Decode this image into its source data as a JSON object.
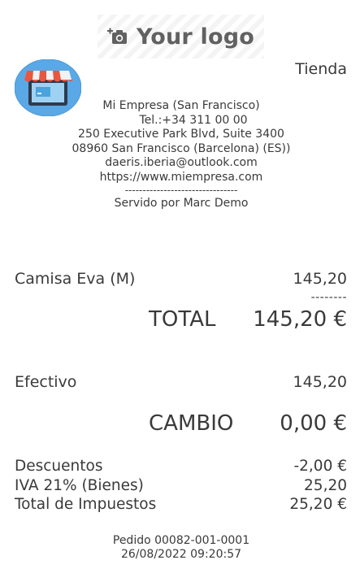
{
  "logo": {
    "text": "Your logo",
    "icon": "camera-plus-icon"
  },
  "shop_icon": "storefront-icon",
  "store_label": "Tienda",
  "company": {
    "name": "Mi Empresa (San Francisco)",
    "phone": "Tel.:+34 311 00 00",
    "address1": "250 Executive Park Blvd, Suite 3400",
    "address2": "08960 San Francisco (Barcelona) (ES))",
    "email": "daeris.iberia@outlook.com",
    "website": "https://www.miempresa.com",
    "separator": "--------------------------------",
    "served_by": "Servido por Marc Demo"
  },
  "order": {
    "lines": [
      {
        "product": "Camisa Eva (M)",
        "amount": "145,20"
      }
    ],
    "subtotal_separator": "--------",
    "total_label": "TOTAL",
    "total_value": "145,20 €",
    "payments": [
      {
        "method": "Efectivo",
        "amount": "145,20"
      }
    ],
    "change_label": "CAMBIO",
    "change_value": "0,00 €",
    "discounts_label": "Descuentos",
    "discounts_value": "-2,00 €",
    "tax_label": "IVA 21% (Bienes)",
    "tax_value": "25,20",
    "tax_total_label": "Total de Impuestos",
    "tax_total_value": "25,20 €"
  },
  "footer": {
    "order_ref": "Pedido 00082-001-0001",
    "datetime": "26/08/2022 09:20:57"
  },
  "colors": {
    "text": "#3a3a3a",
    "logo_text": "#616161",
    "shop_circle": "#5aa9e6",
    "awning_red": "#e8573f"
  }
}
